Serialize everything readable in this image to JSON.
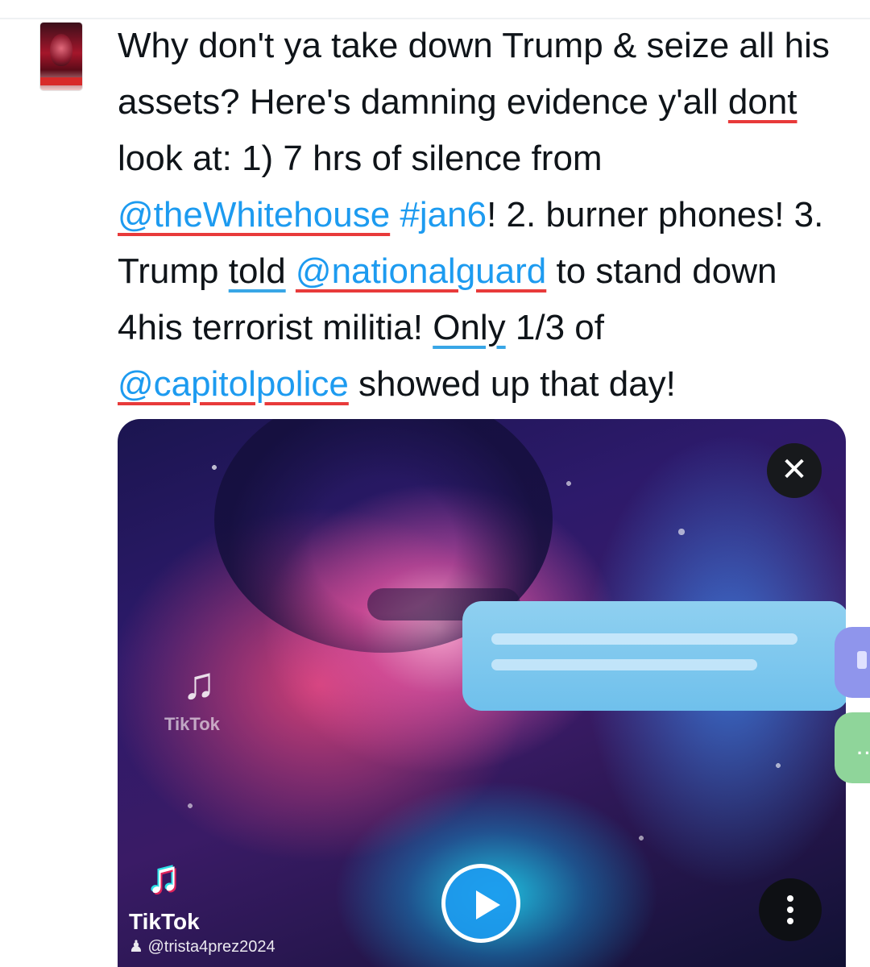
{
  "tweet": {
    "segments": [
      {
        "text": "Why don't ya take down Trump & seize all his assets? Here's damning evidence y'all ",
        "kind": "plain",
        "underline": ""
      },
      {
        "text": "dont",
        "kind": "plain",
        "underline": "red"
      },
      {
        "text": " look at: 1) 7 hrs of silence from ",
        "kind": "plain",
        "underline": ""
      },
      {
        "text": "@theWhitehouse",
        "kind": "mention",
        "underline": "red"
      },
      {
        "text": " ",
        "kind": "plain",
        "underline": ""
      },
      {
        "text": "#jan6",
        "kind": "hashtag",
        "underline": ""
      },
      {
        "text": "! 2. burner phones! 3. Trump ",
        "kind": "plain",
        "underline": ""
      },
      {
        "text": "told",
        "kind": "plain",
        "underline": "blue"
      },
      {
        "text": " ",
        "kind": "plain",
        "underline": ""
      },
      {
        "text": "@nationalguard",
        "kind": "mention",
        "underline": "red"
      },
      {
        "text": " to stand down 4his terrorist militia! ",
        "kind": "plain",
        "underline": ""
      },
      {
        "text": "Only",
        "kind": "plain",
        "underline": "blue"
      },
      {
        "text": " 1/3 of ",
        "kind": "plain",
        "underline": ""
      },
      {
        "text": "@capitolpolice",
        "kind": "mention",
        "underline": "red"
      },
      {
        "text": " showed up that day!",
        "kind": "plain",
        "underline": ""
      }
    ]
  },
  "media": {
    "watermark_mid_logo": "TikTok",
    "watermark_bottom_logo": "TikTok",
    "watermark_bottom_user": "@trista4prez2024"
  },
  "icons": {
    "close": "close-icon",
    "play": "play-icon",
    "more": "more-vertical-icon",
    "tiktok": "tiktok-logo-icon",
    "user": "user-icon"
  },
  "colors": {
    "link": "#1d9bf0",
    "text": "#0f1419",
    "spell_red": "#e83a3a",
    "spell_blue": "#38a6e6"
  }
}
